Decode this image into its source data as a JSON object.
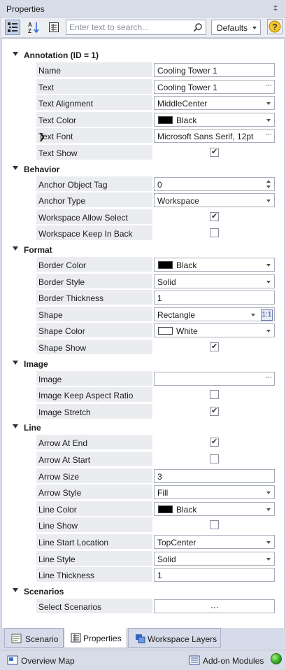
{
  "panel": {
    "title": "Properties"
  },
  "toolbar": {
    "search_placeholder": "Enter text to search...",
    "defaults_label": "Defaults"
  },
  "groups": [
    {
      "label": "Annotation (ID = 1)",
      "rows": [
        {
          "name": "Name",
          "value": "Cooling Tower 1",
          "kind": "text"
        },
        {
          "name": "Text",
          "value": "Cooling Tower 1",
          "kind": "ellipsis"
        },
        {
          "name": "Text Alignment",
          "value": "MiddleCenter",
          "kind": "dropdown"
        },
        {
          "name": "Text Color",
          "value": "Black",
          "kind": "color",
          "color": "#000000"
        },
        {
          "name": "Text Font",
          "value": "Microsoft Sans Serif, 12pt",
          "kind": "ellipsis",
          "expandable": true
        },
        {
          "name": "Text Show",
          "checked": true,
          "kind": "check"
        }
      ]
    },
    {
      "label": "Behavior",
      "rows": [
        {
          "name": "Anchor Object Tag",
          "value": "0",
          "kind": "spinner"
        },
        {
          "name": "Anchor Type",
          "value": "Workspace",
          "kind": "dropdown"
        },
        {
          "name": "Workspace Allow Select",
          "checked": true,
          "kind": "check"
        },
        {
          "name": "Workspace Keep In Back",
          "checked": false,
          "kind": "check"
        }
      ]
    },
    {
      "label": "Format",
      "rows": [
        {
          "name": "Border Color",
          "value": "Black",
          "kind": "color",
          "color": "#000000"
        },
        {
          "name": "Border Style",
          "value": "Solid",
          "kind": "dropdown"
        },
        {
          "name": "Border Thickness",
          "value": "1",
          "kind": "text"
        },
        {
          "name": "Shape",
          "value": "Rectangle",
          "kind": "ratio",
          "ratio_label": "1:1"
        },
        {
          "name": "Shape Color",
          "value": "White",
          "kind": "color",
          "color": "#ffffff"
        },
        {
          "name": "Shape Show",
          "checked": true,
          "kind": "check"
        }
      ]
    },
    {
      "label": "Image",
      "rows": [
        {
          "name": "Image",
          "value": "",
          "kind": "ellipsis"
        },
        {
          "name": "Image Keep Aspect Ratio",
          "checked": false,
          "kind": "check"
        },
        {
          "name": "Image Stretch",
          "checked": true,
          "kind": "check"
        }
      ]
    },
    {
      "label": "Line",
      "rows": [
        {
          "name": "Arrow At End",
          "checked": true,
          "kind": "check"
        },
        {
          "name": "Arrow At Start",
          "checked": false,
          "kind": "check"
        },
        {
          "name": "Arrow Size",
          "value": "3",
          "kind": "text"
        },
        {
          "name": "Arrow Style",
          "value": "Fill",
          "kind": "dropdown"
        },
        {
          "name": "Line Color",
          "value": "Black",
          "kind": "color",
          "color": "#000000"
        },
        {
          "name": "Line Show",
          "checked": false,
          "kind": "check"
        },
        {
          "name": "Line Start Location",
          "value": "TopCenter",
          "kind": "dropdown"
        },
        {
          "name": "Line Style",
          "value": "Solid",
          "kind": "dropdown"
        },
        {
          "name": "Line Thickness",
          "value": "1",
          "kind": "text"
        }
      ]
    },
    {
      "label": "Scenarios",
      "rows": [
        {
          "name": "Select  Scenarios",
          "value": "",
          "kind": "button"
        }
      ]
    }
  ],
  "tabs": [
    {
      "label": "Scenario",
      "icon": "scenario-icon",
      "active": false
    },
    {
      "label": "Properties",
      "icon": "properties-icon",
      "active": true
    },
    {
      "label": "Workspace Layers",
      "icon": "workspace-layers-icon",
      "active": false
    }
  ],
  "status": {
    "overview_label": "Overview Map",
    "addon_label": "Add-on Modules",
    "indicator_color": "#2fa21c"
  }
}
